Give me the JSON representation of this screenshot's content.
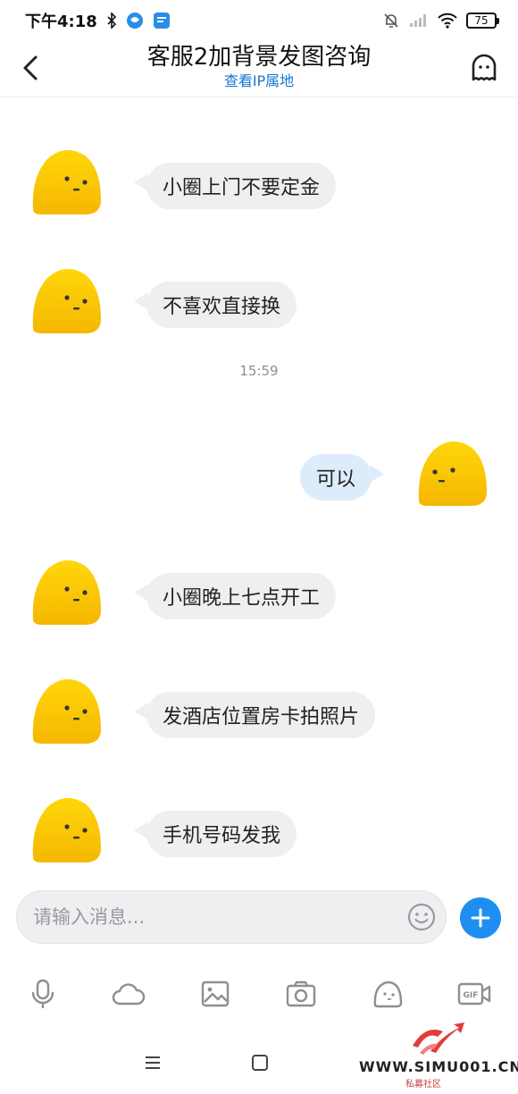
{
  "status_bar": {
    "time": "下午4:18",
    "battery": "75",
    "icons": [
      "bluetooth-icon",
      "app-notification-icon",
      "app-notification-icon",
      "bell-muted-icon",
      "signal-icon",
      "wifi-icon",
      "battery-icon"
    ]
  },
  "header": {
    "title": "客服2加背景发图咨询",
    "subtitle": "查看IP属地",
    "back_icon": "chevron-left-icon",
    "profile_icon": "ghost-profile-icon"
  },
  "messages": [
    {
      "direction": "incoming",
      "text": "小圈上门不要定金"
    },
    {
      "direction": "incoming",
      "text": "不喜欢直接换"
    },
    {
      "direction": "outgoing",
      "text": "可以"
    },
    {
      "direction": "incoming",
      "text": "小圈晚上七点开工"
    },
    {
      "direction": "incoming",
      "text": "发酒店位置房卡拍照片"
    },
    {
      "direction": "incoming",
      "text": "手机号码发我"
    }
  ],
  "timestamp": "15:59",
  "input": {
    "placeholder": "请输入消息..."
  },
  "toolbar": [
    "microphone-icon",
    "cloud-icon",
    "image-icon",
    "camera-icon",
    "sticker-icon",
    "gif-icon"
  ],
  "nav": [
    "menu-icon",
    "home-icon"
  ],
  "watermark": {
    "text": "WWW.SIMU001.CN",
    "sub": "私募社区"
  },
  "colors": {
    "accent": "#1e8ff0",
    "incoming_bubble": "#efeff1",
    "outgoing_bubble": "#dcecfb",
    "avatar": "#f8c300"
  }
}
